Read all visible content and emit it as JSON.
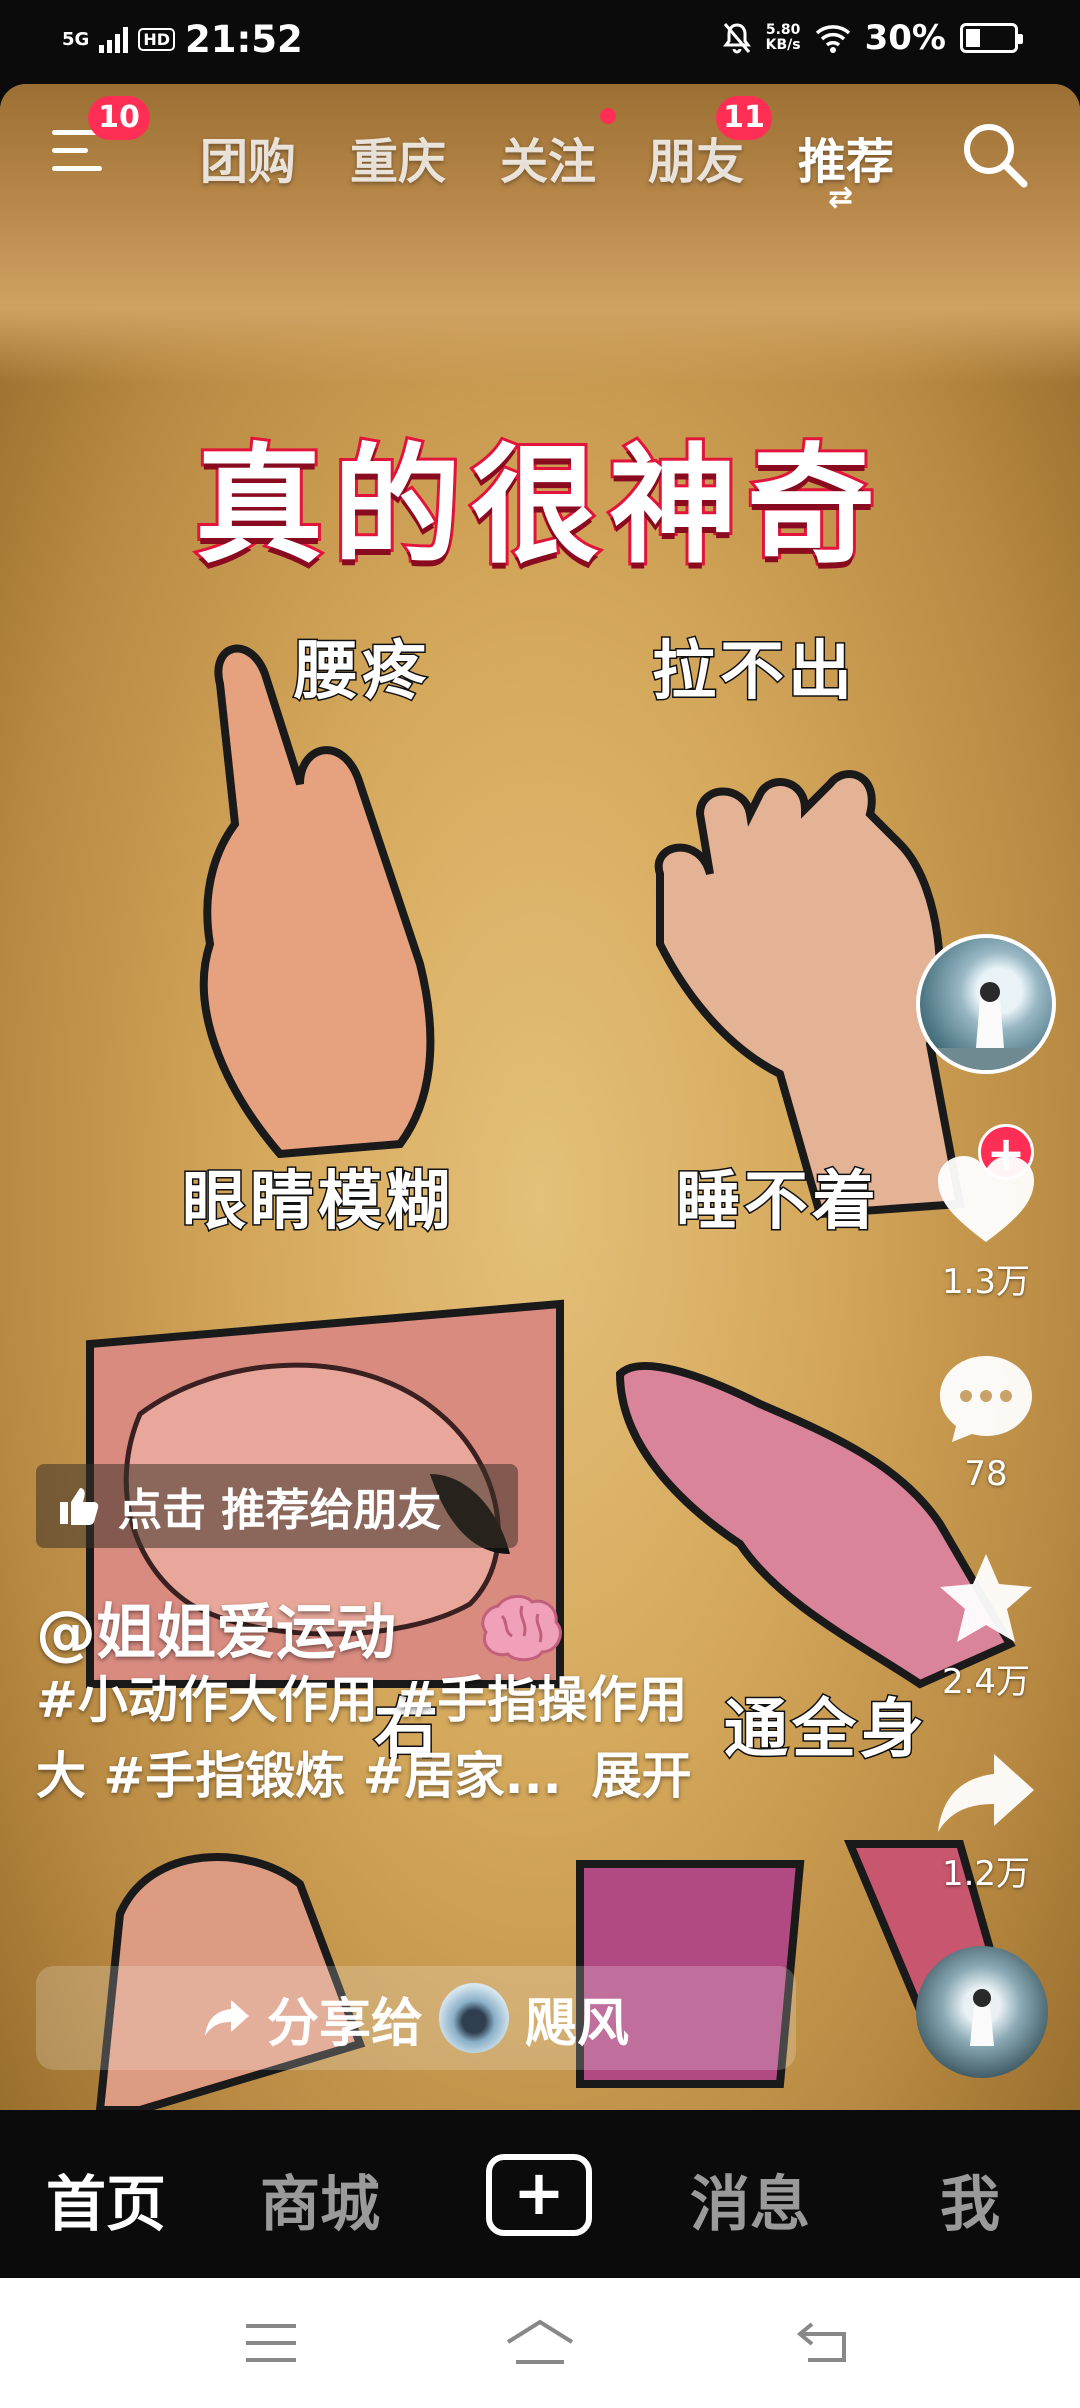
{
  "status_bar": {
    "network": "5G",
    "hd": "HD",
    "time": "21:52",
    "speed_value": "5.80",
    "speed_unit": "KB/s",
    "battery": "30%",
    "battery_level": 0.3
  },
  "top_nav": {
    "menu_badge": "10",
    "tabs": [
      "团购",
      "重庆",
      "关注",
      "朋友",
      "推荐"
    ],
    "friends_badge": "11",
    "active_tab": "推荐",
    "swap_glyph": "⇄"
  },
  "video": {
    "title": "真的很神奇",
    "labels": [
      "腰疼",
      "拉不出",
      "眼睛模糊",
      "睡不着",
      "通全身"
    ],
    "overlap_text": "右"
  },
  "actions": {
    "like_count": "1.3万",
    "comment_count": "78",
    "favorite_count": "2.4万",
    "share_count": "1.2万"
  },
  "recommend_bar": {
    "label": "点击 推荐给朋友"
  },
  "post": {
    "author": "@姐姐爱运动",
    "hashtags_line1": "#小动作大作用 #手指操作用",
    "hashtags_line2": "大 #手指锻炼 #居家...",
    "expand": "展开"
  },
  "share_bar": {
    "label": "分享给",
    "contact": "飓风"
  },
  "bottom_nav": {
    "items": [
      "首页",
      "商城",
      "消息",
      "我"
    ],
    "plus": "+"
  },
  "colors": {
    "accent_red": "#ff2e55",
    "title_stroke": "#e2143c",
    "background": "#0b0b0b"
  }
}
